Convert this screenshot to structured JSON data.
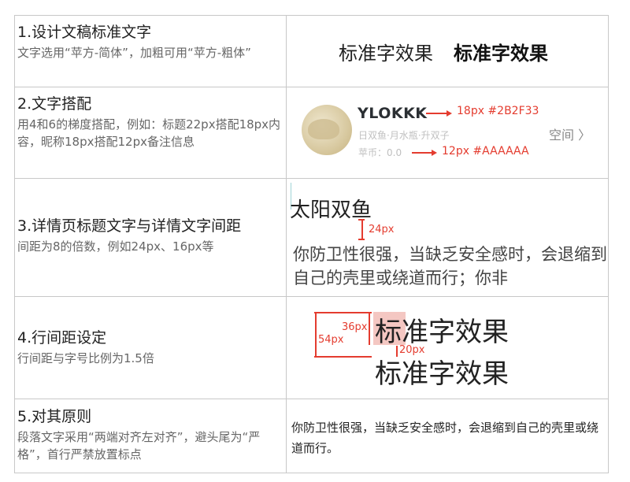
{
  "rows": [
    {
      "title": "1.设计文稿标准文字",
      "desc": "文字选用“苹方-简体”，加粗可用“苹方-粗体”"
    },
    {
      "title": "2.文字搭配",
      "desc": "用4和6的梯度搭配，例如：标题22px搭配18px内容，昵称18px搭配12px备注信息"
    },
    {
      "title": "3.详情页标题文字与详情文字间距",
      "desc": "间距为8的倍数，例如24px、16px等"
    },
    {
      "title": "4.行间距设定",
      "desc": "行间距与字号比例为1.5倍"
    },
    {
      "title": "5.对其原则",
      "desc": "段落文字采用“两端对齐左对齐”，避头尾为“严格”，首行严禁放置标点"
    }
  ],
  "example1": {
    "normal": "标准字效果",
    "bold": "标准字效果"
  },
  "example2": {
    "nickname": "YLOKKK",
    "sub_line1": "日双鱼·月水瓶·升双子",
    "sub_line2": "苹币：0.0",
    "annotation_nick": "18px  #2B2F33",
    "annotation_sub": "12px  #AAAAAA",
    "space_label": "空间 〉"
  },
  "example3": {
    "title": "太阳双鱼",
    "spacing_label": "24px",
    "paragraph": "你防卫性很强，当缺乏安全感时，会退缩到自己的壳里或绕道而行；你非"
  },
  "example4": {
    "line1": "标准字效果",
    "line2": "标准字效果",
    "label_54": "54px",
    "label_36": "36px",
    "label_20": "20px"
  },
  "example5": {
    "paragraph": "你防卫性很强，当缺乏安全感时，会退缩到自己的壳里或绕道而行。"
  },
  "colors": {
    "annotation_red": "#e43c2f",
    "nickname_color": "#2B2F33",
    "sub_color": "#AAAAAA",
    "highlight": "#f4c7c2"
  }
}
